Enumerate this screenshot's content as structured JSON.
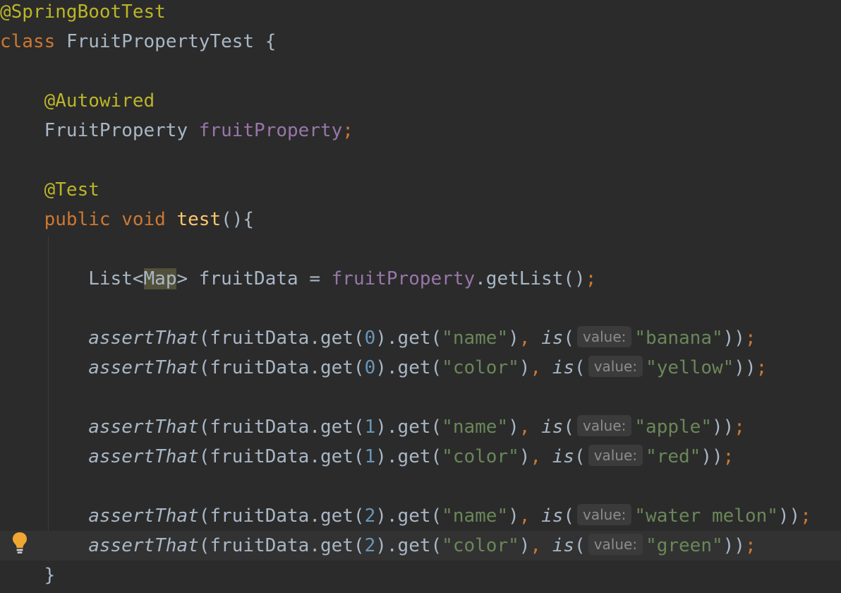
{
  "code": {
    "annotation_springboottest": "@SpringBootTest",
    "kw_class": "class",
    "class_name": "FruitPropertyTest",
    "open_brace": "{",
    "annotation_autowired": "@Autowired",
    "field_type": "FruitProperty",
    "field_name": "fruitProperty",
    "semicolon": ";",
    "annotation_test": "@Test",
    "kw_public": "public",
    "kw_void": "void",
    "method_name": "test",
    "method_parens_open": "(){",
    "list_type": "List<",
    "map_type": "Map",
    "list_type_close": ">",
    "var_decl": " fruitData = ",
    "field_ref": "fruitProperty",
    "get_list_call": ".getList()",
    "close_brace": "}",
    "assert_fn": "assertThat",
    "call_open": "(fruitData.get(",
    "call_mid": ").get(",
    "call_close": ")",
    "comma": ",",
    "is_fn": "is",
    "paren_open": "(",
    "paren_close_double": "))",
    "hint_label": "value:",
    "asserts": [
      {
        "index": "0",
        "key": "\"name\"",
        "value": "\"banana\""
      },
      {
        "index": "0",
        "key": "\"color\"",
        "value": "\"yellow\""
      },
      {
        "index": "1",
        "key": "\"name\"",
        "value": "\"apple\""
      },
      {
        "index": "1",
        "key": "\"color\"",
        "value": "\"red\""
      },
      {
        "index": "2",
        "key": "\"name\"",
        "value": "\"water melon\""
      },
      {
        "index": "2",
        "key": "\"color\"",
        "value": "\"green\""
      }
    ]
  },
  "icons": {
    "intention_bulb": "lightbulb-icon"
  },
  "colors": {
    "background": "#2b2b2b",
    "annotation": "#bbb529",
    "keyword": "#cc7832",
    "method_decl": "#ffc66d",
    "field": "#9876aa",
    "string": "#6a8759",
    "number": "#6897bb",
    "text": "#a9b7c6"
  }
}
